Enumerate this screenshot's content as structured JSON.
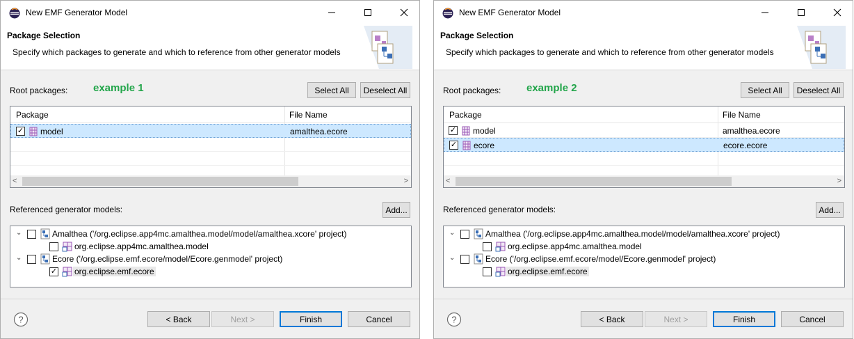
{
  "dialogs": [
    {
      "window_title": "New EMF Generator Model",
      "header_title": "Package Selection",
      "header_description": "Specify which packages to generate and which to reference from other generator models",
      "example_label": "example 1",
      "root_packages_label": "Root packages:",
      "select_all_label": "Select All",
      "deselect_all_label": "Deselect All",
      "columns": [
        "Package",
        "File Name"
      ],
      "packages": [
        {
          "name": "model",
          "file": "amalthea.ecore",
          "checked": true,
          "selected": true
        }
      ],
      "referenced_label": "Referenced generator models:",
      "add_label": "Add...",
      "tree": [
        {
          "text": "Amalthea ('/org.eclipse.app4mc.amalthea.model/model/amalthea.xcore' project)",
          "level": 0,
          "checked": false
        },
        {
          "text": "org.eclipse.app4mc.amalthea.model",
          "level": 1,
          "checked": false
        },
        {
          "text": "Ecore ('/org.eclipse.emf.ecore/model/Ecore.genmodel' project)",
          "level": 0,
          "checked": false
        },
        {
          "text": "org.eclipse.emf.ecore",
          "level": 1,
          "checked": true,
          "highlight": true
        }
      ],
      "buttons": {
        "back": "< Back",
        "next": "Next >",
        "finish": "Finish",
        "cancel": "Cancel"
      }
    },
    {
      "window_title": "New EMF Generator Model",
      "header_title": "Package Selection",
      "header_description": "Specify which packages to generate and which to reference from other generator models",
      "example_label": "example 2",
      "root_packages_label": "Root packages:",
      "select_all_label": "Select All",
      "deselect_all_label": "Deselect All",
      "columns": [
        "Package",
        "File Name"
      ],
      "packages": [
        {
          "name": "model",
          "file": "amalthea.ecore",
          "checked": true,
          "selected": false
        },
        {
          "name": "ecore",
          "file": "ecore.ecore",
          "checked": true,
          "selected": true
        }
      ],
      "referenced_label": "Referenced generator models:",
      "add_label": "Add...",
      "tree": [
        {
          "text": "Amalthea ('/org.eclipse.app4mc.amalthea.model/model/amalthea.xcore' project)",
          "level": 0,
          "checked": false
        },
        {
          "text": "org.eclipse.app4mc.amalthea.model",
          "level": 1,
          "checked": false
        },
        {
          "text": "Ecore ('/org.eclipse.emf.ecore/model/Ecore.genmodel' project)",
          "level": 0,
          "checked": false
        },
        {
          "text": "org.eclipse.emf.ecore",
          "level": 1,
          "checked": false,
          "highlight": true
        }
      ],
      "buttons": {
        "back": "< Back",
        "next": "Next >",
        "finish": "Finish",
        "cancel": "Cancel"
      }
    }
  ]
}
